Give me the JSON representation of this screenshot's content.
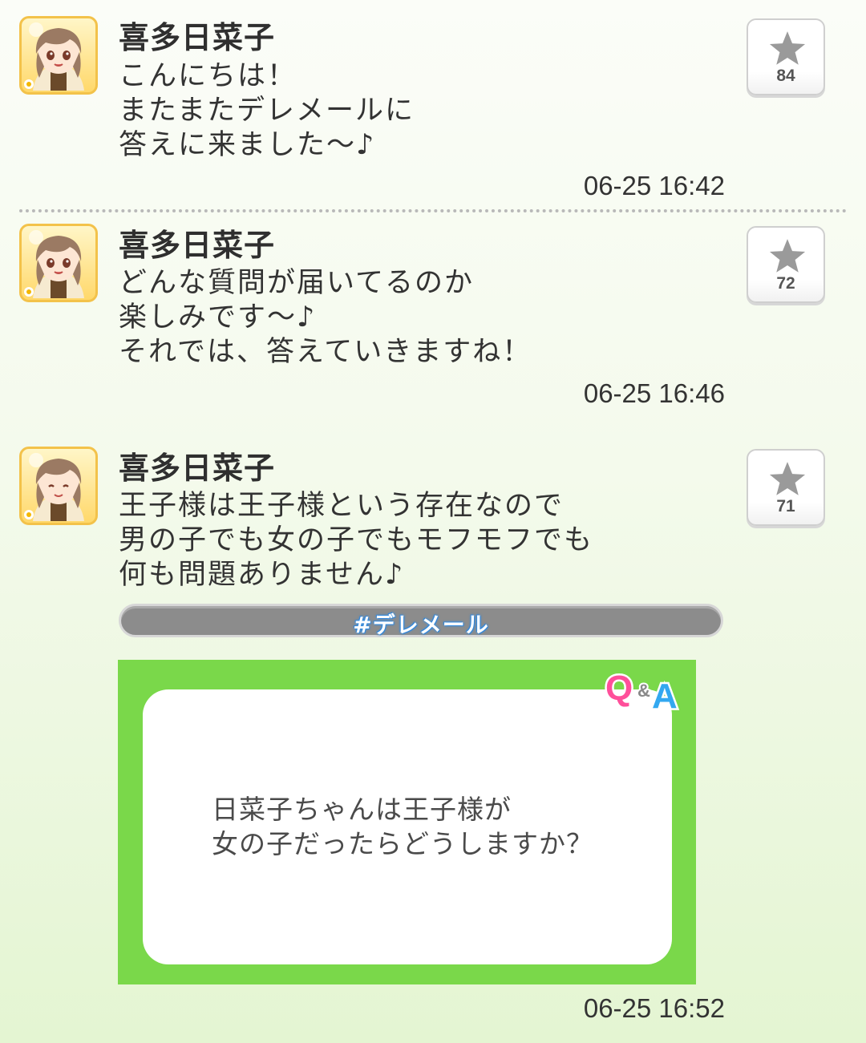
{
  "posts": [
    {
      "author": "喜多日菜子",
      "message": "こんにちは！\nまたまたデレメールに\n答えに来ました～♪",
      "timestamp": "06-25 16:42",
      "favorite_count": "84"
    },
    {
      "author": "喜多日菜子",
      "message": "どんな質問が届いてるのか\n楽しみです～♪\nそれでは、答えていきますね！",
      "timestamp": "06-25 16:46",
      "favorite_count": "72"
    },
    {
      "author": "喜多日菜子",
      "message": "王子様は王子様という存在なので\n男の子でも女の子でもモフモフでも\n何も問題ありません♪",
      "timestamp": "06-25 16:52",
      "favorite_count": "71",
      "hashtag": "#デレメール",
      "qa_card": {
        "logo_q": "Q",
        "logo_and": "&",
        "logo_a": "A",
        "question": "日菜子ちゃんは王子様が\n女の子だったらどうしますか？"
      }
    }
  ],
  "colors": {
    "qa_green": "#7ad84a",
    "hashtag_bg": "#8c8c8c",
    "star": "#9a9a9a"
  },
  "icons": [
    "character-avatar",
    "star-icon",
    "qa-logo"
  ]
}
